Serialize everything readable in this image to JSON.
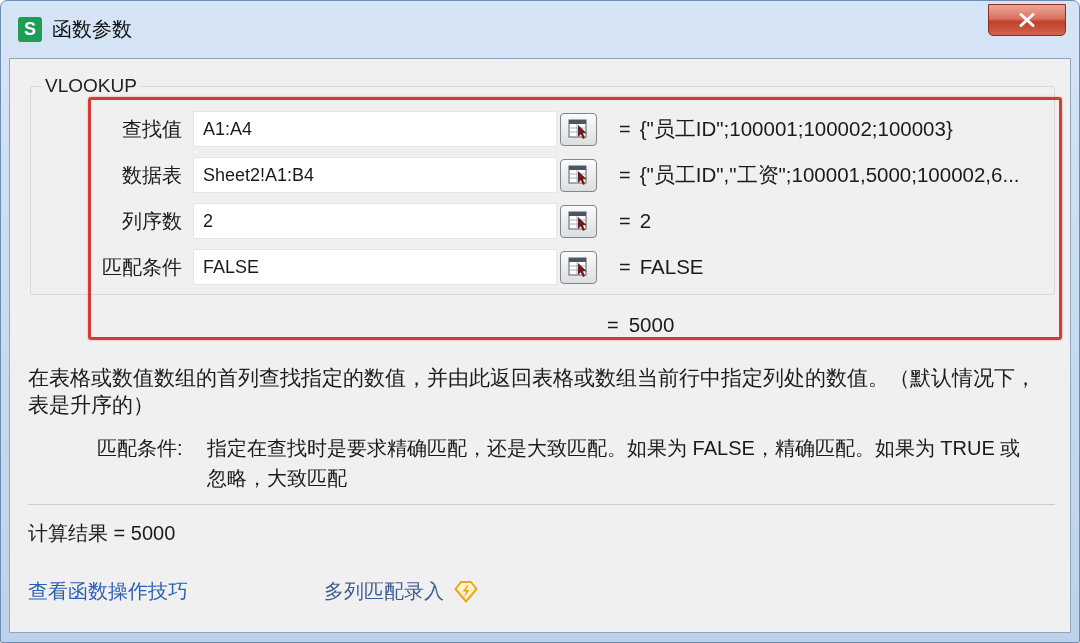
{
  "window": {
    "icon_letter": "S",
    "title": "函数参数"
  },
  "function_group": {
    "name": "VLOOKUP",
    "highlighted": true,
    "arguments": [
      {
        "label": "查找值",
        "value": "A1:A4",
        "equals": "=",
        "result": "{\"员工ID\";100001;100002;100003}"
      },
      {
        "label": "数据表",
        "value": "Sheet2!A1:B4",
        "equals": "=",
        "result": "{\"员工ID\",\"工资\";100001,5000;100002,6..."
      },
      {
        "label": "列序数",
        "value": "2",
        "equals": "=",
        "result": "2"
      },
      {
        "label": "匹配条件",
        "value": "FALSE",
        "equals": "=",
        "result": "FALSE"
      }
    ],
    "result": {
      "equals": "=",
      "value": "5000"
    }
  },
  "description": "在表格或数值数组的首列查找指定的数值，并由此返回表格或数组当前行中指定列处的数值。（默认情况下，表是升序的）",
  "argument_help": {
    "label": "匹配条件:",
    "text": "指定在查找时是要求精确匹配，还是大致匹配。如果为 FALSE，精确匹配。如果为 TRUE 或忽略，大致匹配"
  },
  "calculation_result": "计算结果 = 5000",
  "links": [
    {
      "label": "查看函数操作技巧",
      "kind": "plain"
    },
    {
      "label": "多列匹配录入",
      "kind": "premium"
    }
  ]
}
